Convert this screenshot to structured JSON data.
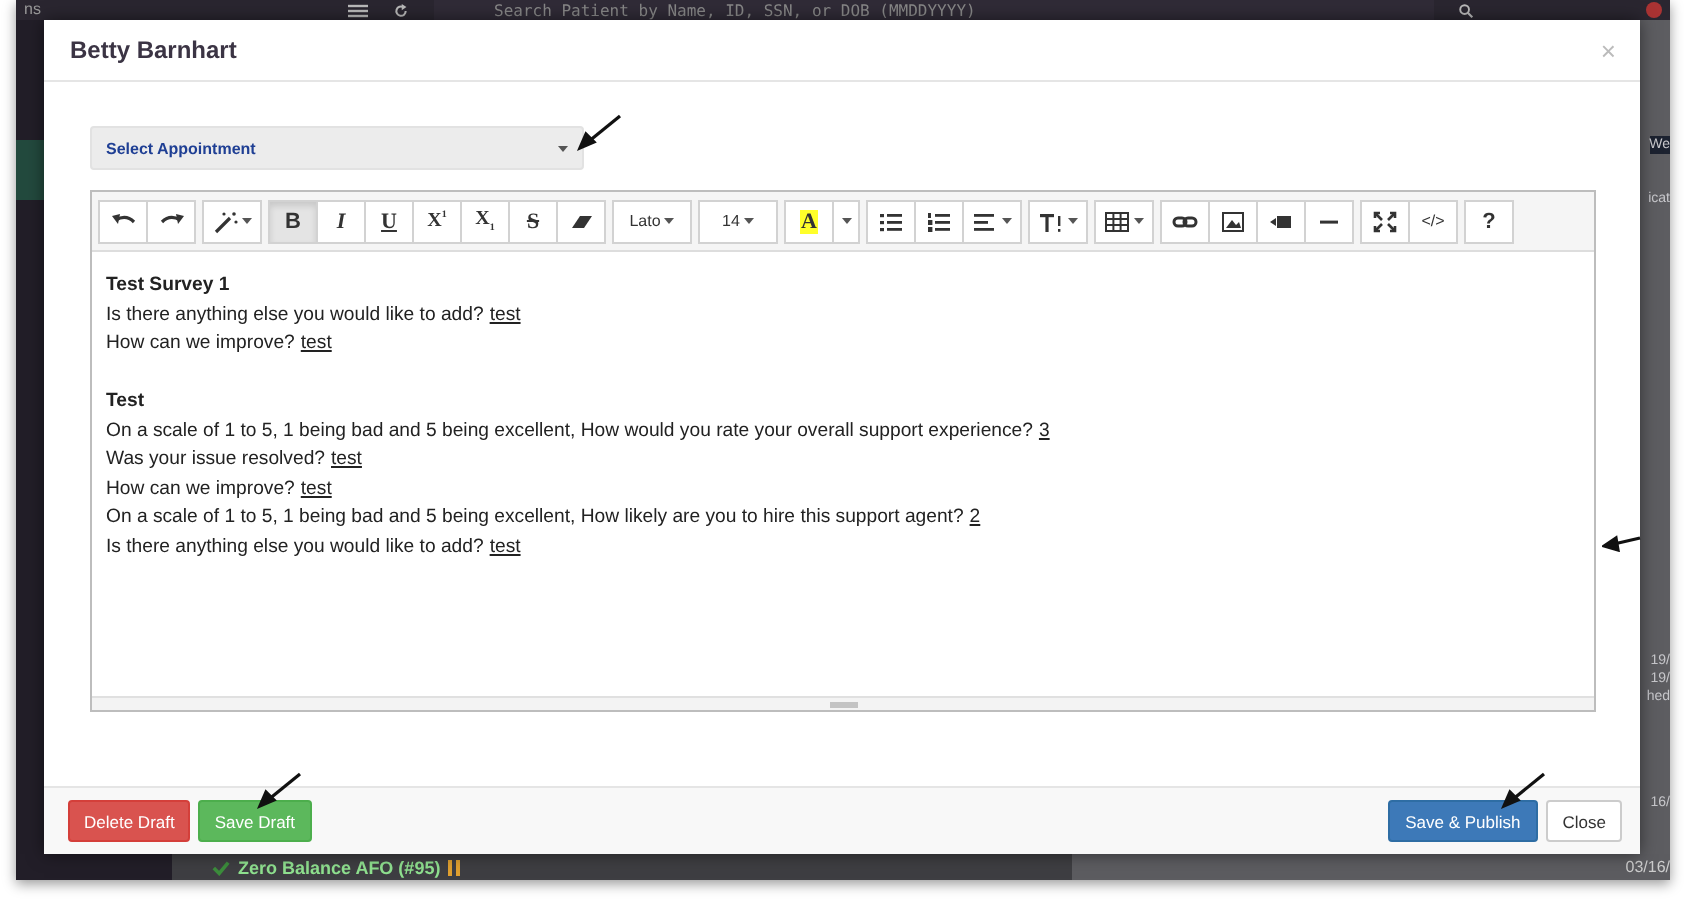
{
  "background": {
    "top_bar": {
      "menu_text": "ns",
      "search": {
        "placeholder": "Search Patient by Name, ID, SSN, or DOB (MMDDYYYY)"
      }
    },
    "side_fragments": [
      "We",
      "icat",
      "19/",
      "19/",
      "hed",
      "16/"
    ],
    "bottom_row": {
      "task": "Zero Balance AFO (#95)",
      "date": "03/16/"
    }
  },
  "modal": {
    "title": "Betty Barnhart",
    "close": "×",
    "appointment_select": {
      "placeholder": "Select Appointment"
    },
    "editor": {
      "toolbar": [
        [
          {
            "kind": "undo",
            "active": false
          },
          {
            "kind": "redo",
            "active": false
          }
        ],
        [
          {
            "kind": "magic",
            "active": false
          }
        ],
        [
          {
            "kind": "bold",
            "label": "B",
            "active": true
          },
          {
            "kind": "italic",
            "label": "I",
            "active": false
          },
          {
            "kind": "underline",
            "label": "U",
            "active": false
          },
          {
            "kind": "superscript",
            "label": "X$^{1}$",
            "active": false
          },
          {
            "kind": "subscript",
            "label": "X$_{1}$",
            "active": false
          },
          {
            "kind": "strike",
            "label": "S",
            "active": false
          },
          {
            "kind": "eraser",
            "active": false
          }
        ],
        [
          {
            "kind": "dropdown",
            "label": "Lato",
            "active": false
          }
        ],
        [
          {
            "kind": "dropdown",
            "label": "14",
            "active": false
          }
        ],
        [
          {
            "kind": "highlight",
            "label": "A",
            "active": false
          },
          {
            "kind": "caret",
            "active": false
          }
        ],
        [
          {
            "kind": "bullets",
            "active": false
          },
          {
            "kind": "numbers",
            "active": false
          },
          {
            "kind": "align",
            "active": false
          }
        ],
        [
          {
            "kind": "line-height",
            "active": false
          }
        ],
        [
          {
            "kind": "table",
            "active": false
          }
        ],
        [
          {
            "kind": "link",
            "active": false
          },
          {
            "kind": "picture",
            "active": false
          },
          {
            "kind": "video",
            "active": false
          },
          {
            "kind": "rule",
            "active": false
          }
        ],
        [
          {
            "kind": "fullscreen",
            "active": false
          },
          {
            "kind": "code",
            "label": "</>",
            "active": false
          }
        ],
        [
          {
            "kind": "help",
            "label": "?",
            "active": false
          }
        ]
      ],
      "sections": [
        {
          "title": "Test Survey 1",
          "items": [
            {
              "question": "Is there anything else you would like to add?",
              "answer": "test"
            },
            {
              "question": "How can we improve?",
              "answer": "test"
            }
          ]
        },
        {
          "title": "Test",
          "items": [
            {
              "question": "On a scale of 1 to 5, 1 being bad and 5 being excellent, How would you rate your overall support experience?",
              "answer": "3"
            },
            {
              "question": "Was your issue resolved?",
              "answer": "test"
            },
            {
              "question": "How can we improve?",
              "answer": "test"
            },
            {
              "question": "On a scale of 1 to 5, 1 being bad and 5 being excellent, How likely are you to hire this support agent?",
              "answer": "2"
            },
            {
              "question": "Is there anything else you would like to add?",
              "answer": "test"
            }
          ]
        }
      ]
    },
    "footer": {
      "left": [
        {
          "label": "Delete Draft",
          "kind": "danger"
        },
        {
          "label": "Save Draft",
          "kind": "success"
        }
      ],
      "right": [
        {
          "label": "Save & Publish",
          "kind": "primary"
        },
        {
          "label": "Close",
          "kind": "default"
        }
      ]
    }
  }
}
